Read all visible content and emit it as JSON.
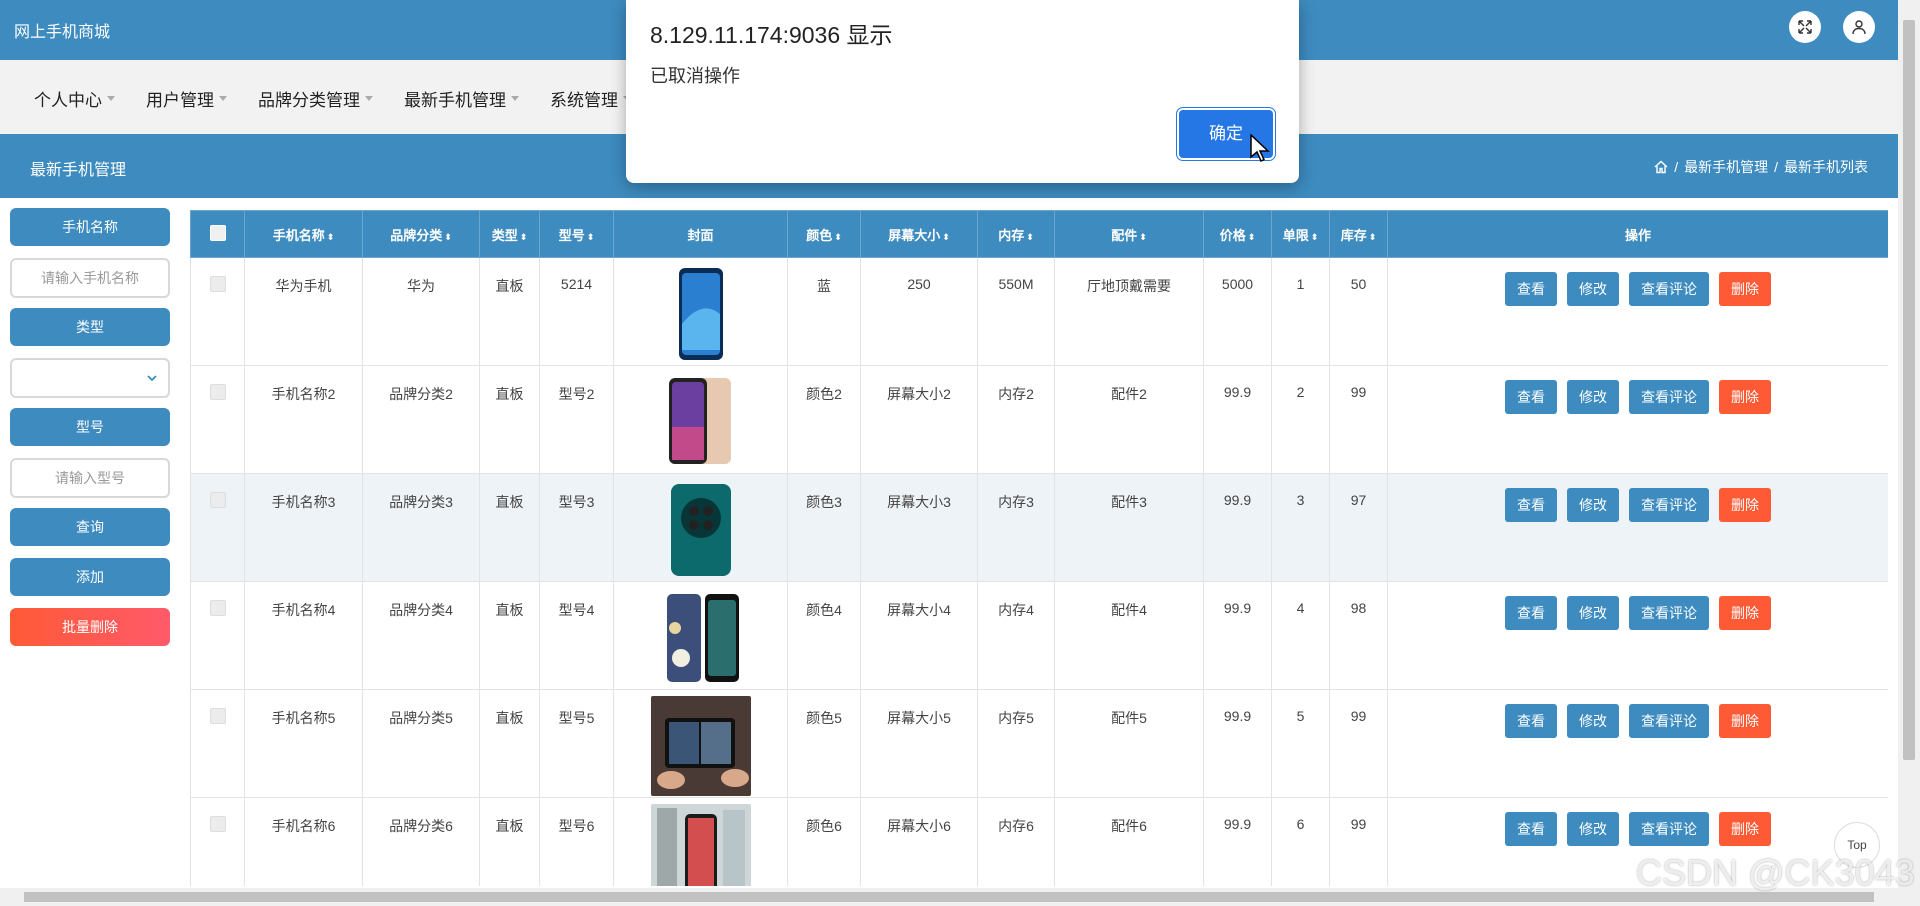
{
  "app": {
    "brand": "网上手机商城"
  },
  "menu": [
    {
      "label": "个人中心"
    },
    {
      "label": "用户管理"
    },
    {
      "label": "品牌分类管理"
    },
    {
      "label": "最新手机管理"
    },
    {
      "label": "系统管理"
    }
  ],
  "subheader": {
    "title": "最新手机管理",
    "breadcrumb": [
      "最新手机管理",
      "最新手机列表"
    ],
    "separator": "/"
  },
  "sidebar": {
    "name_label": "手机名称",
    "name_placeholder": "请输入手机名称",
    "type_label": "类型",
    "type_value": "",
    "model_label": "型号",
    "model_placeholder": "请输入型号",
    "query_button": "查询",
    "add_button": "添加",
    "batch_delete_button": "批量删除"
  },
  "table": {
    "sort_glyph": "⬍",
    "headers": [
      "手机名称",
      "品牌分类",
      "类型",
      "型号",
      "封面",
      "颜色",
      "屏幕大小",
      "内存",
      "配件",
      "价格",
      "单限",
      "库存",
      "操作"
    ],
    "rows": [
      {
        "name": "华为手机",
        "brand": "华为",
        "type": "直板",
        "model": "5214",
        "color": "蓝",
        "screen": "250",
        "memory": "550M",
        "accessory": "厅地顶戴需要",
        "price": "5000",
        "limit": "1",
        "stock": "50",
        "cover": "phone-blue"
      },
      {
        "name": "手机名称2",
        "brand": "品牌分类2",
        "type": "直板",
        "model": "型号2",
        "color": "颜色2",
        "screen": "屏幕大小2",
        "memory": "内存2",
        "accessory": "配件2",
        "price": "99.9",
        "limit": "2",
        "stock": "99",
        "cover": "phone-gold"
      },
      {
        "name": "手机名称3",
        "brand": "品牌分类3",
        "type": "直板",
        "model": "型号3",
        "color": "颜色3",
        "screen": "屏幕大小3",
        "memory": "内存3",
        "accessory": "配件3",
        "price": "99.9",
        "limit": "3",
        "stock": "97",
        "cover": "phone-green"
      },
      {
        "name": "手机名称4",
        "brand": "品牌分类4",
        "type": "直板",
        "model": "型号4",
        "color": "颜色4",
        "screen": "屏幕大小4",
        "memory": "内存4",
        "accessory": "配件4",
        "price": "99.9",
        "limit": "4",
        "stock": "98",
        "cover": "phone-floral"
      },
      {
        "name": "手机名称5",
        "brand": "品牌分类5",
        "type": "直板",
        "model": "型号5",
        "color": "颜色5",
        "screen": "屏幕大小5",
        "memory": "内存5",
        "accessory": "配件5",
        "price": "99.9",
        "limit": "5",
        "stock": "99",
        "cover": "phone-foldable"
      },
      {
        "name": "手机名称6",
        "brand": "品牌分类6",
        "type": "直板",
        "model": "型号6",
        "color": "颜色6",
        "screen": "屏幕大小6",
        "memory": "内存6",
        "accessory": "配件6",
        "price": "99.9",
        "limit": "6",
        "stock": "99",
        "cover": "phone-store"
      }
    ],
    "actions": {
      "view": "查看",
      "edit": "修改",
      "reviews": "查看评论",
      "delete": "删除"
    }
  },
  "dialog": {
    "title": "8.129.11.174:9036 显示",
    "message": "已取消操作",
    "ok": "确定"
  },
  "back_to_top": "Top",
  "watermark": "CSDN @CK3043",
  "colors": {
    "primary": "#3d8bbf",
    "danger": "#ff5a36",
    "dialog_button": "#2677e6"
  }
}
